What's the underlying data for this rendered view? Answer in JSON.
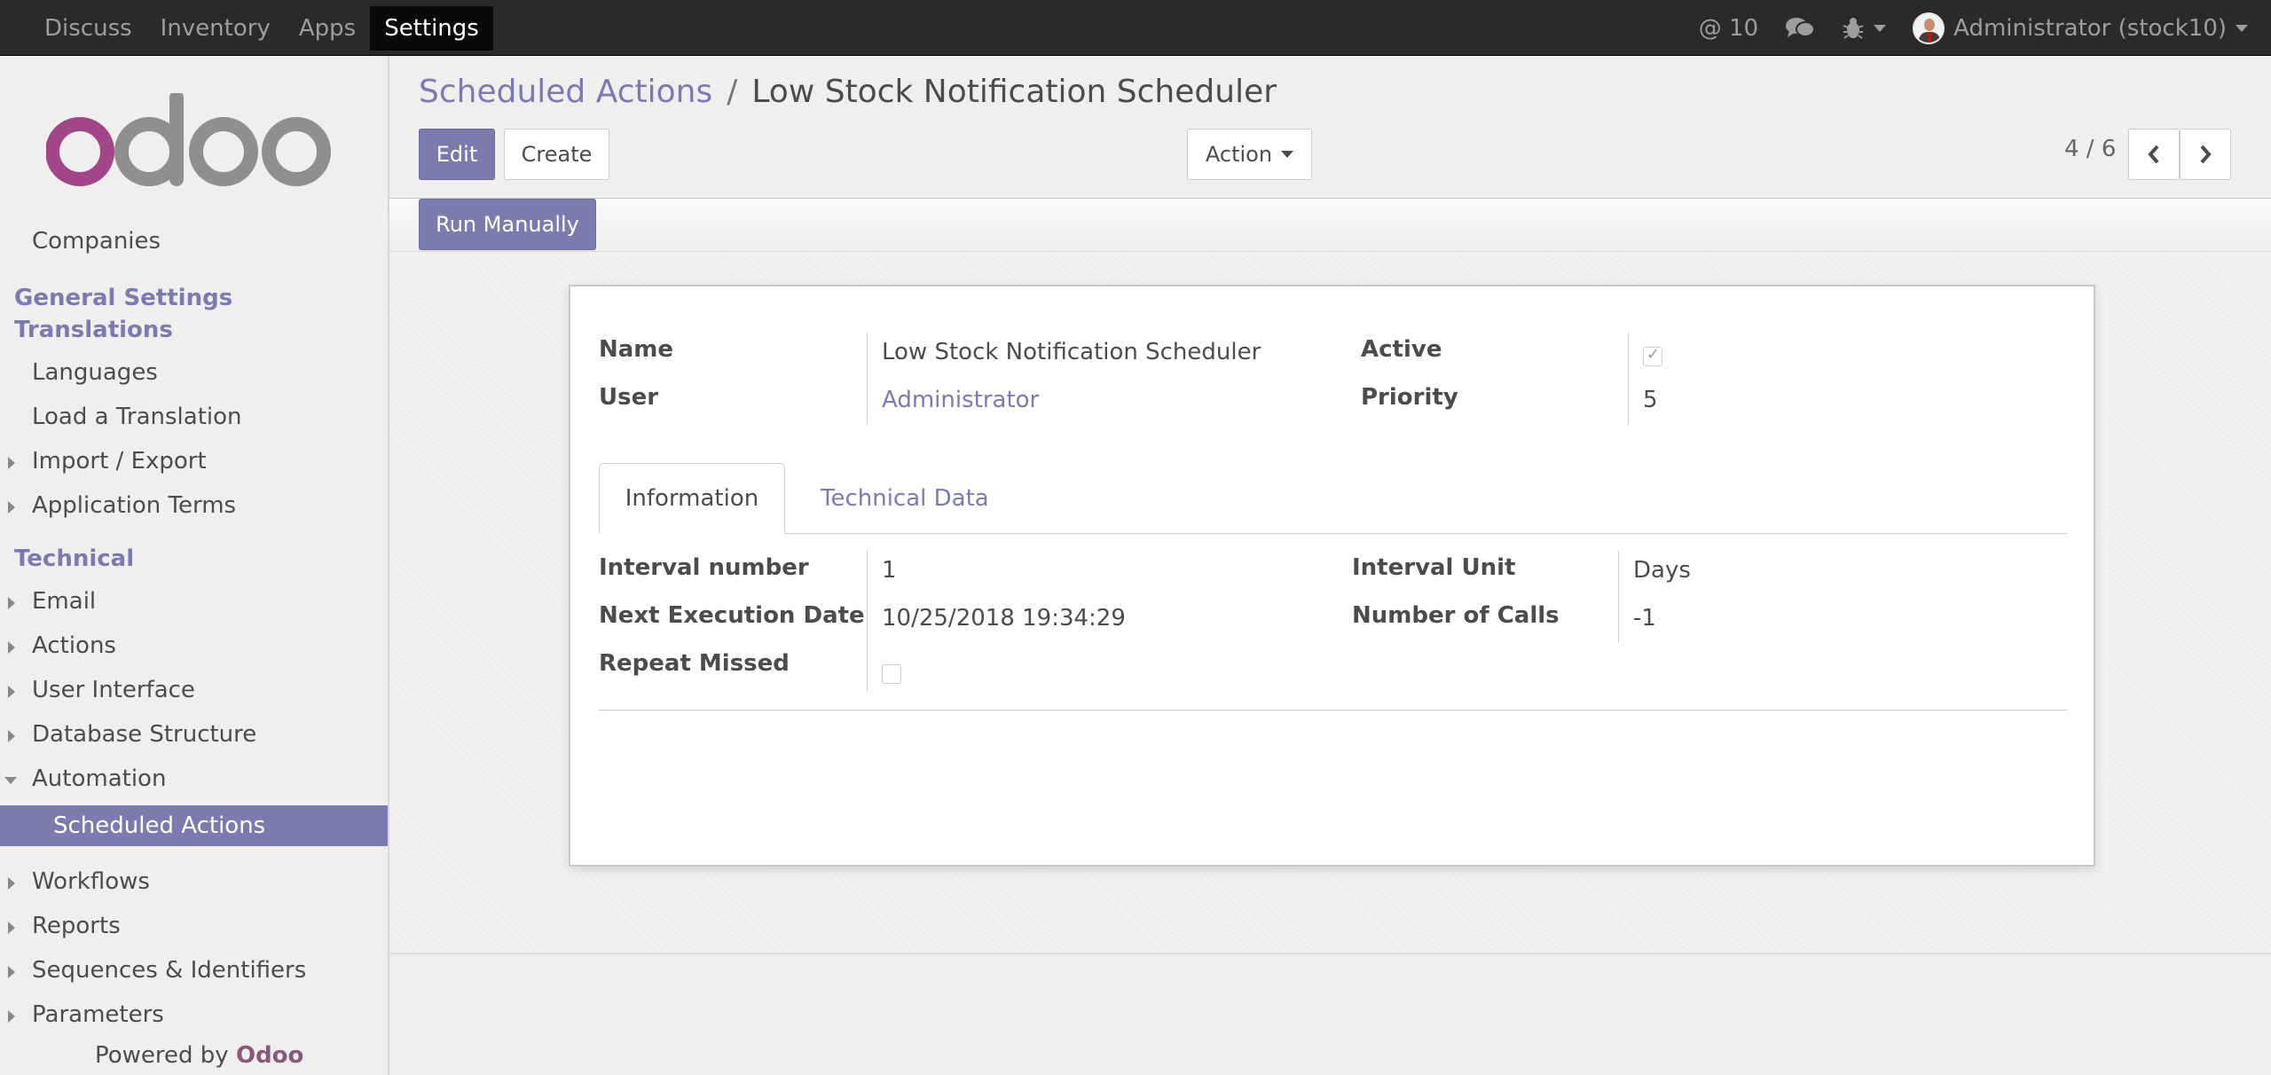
{
  "topbar": {
    "menu": [
      "Discuss",
      "Inventory",
      "Apps",
      "Settings"
    ],
    "active_menu": "Settings",
    "messages_count": "@ 10",
    "user_label": "Administrator (stock10)"
  },
  "sidebar": {
    "cut_item": "Companies",
    "general_settings": "General Settings",
    "translations": "Translations",
    "languages": "Languages",
    "load_translation": "Load a Translation",
    "import_export": "Import / Export",
    "application_terms": "Application Terms",
    "technical": "Technical",
    "email": "Email",
    "actions": "Actions",
    "user_interface": "User Interface",
    "database_structure": "Database Structure",
    "automation": "Automation",
    "scheduled_actions": "Scheduled Actions",
    "workflows": "Workflows",
    "reports": "Reports",
    "sequences": "Sequences & Identifiers",
    "parameters": "Parameters",
    "powered_by": "Powered by",
    "powered_brand": "Odoo"
  },
  "breadcrumb": {
    "parent": "Scheduled Actions",
    "separator": "/",
    "current": "Low Stock Notification Scheduler"
  },
  "buttons": {
    "edit": "Edit",
    "create": "Create",
    "action": "Action",
    "run_manually": "Run Manually"
  },
  "pager": {
    "text": "4 / 6"
  },
  "form": {
    "name_label": "Name",
    "name_value": "Low Stock Notification Scheduler",
    "user_label": "User",
    "user_value": "Administrator",
    "active_label": "Active",
    "active_checked": true,
    "priority_label": "Priority",
    "priority_value": "5",
    "tabs": [
      "Information",
      "Technical Data"
    ],
    "interval_number_label": "Interval number",
    "interval_number_value": "1",
    "next_execution_label": "Next Execution Date",
    "next_execution_value": "10/25/2018 19:34:29",
    "repeat_missed_label": "Repeat Missed",
    "repeat_missed_checked": false,
    "interval_unit_label": "Interval Unit",
    "interval_unit_value": "Days",
    "number_of_calls_label": "Number of Calls",
    "number_of_calls_value": "-1"
  },
  "colors": {
    "accent": "#7c7bad",
    "navbar": "#2a2a2a",
    "odoo_brand": "#875a7b"
  }
}
